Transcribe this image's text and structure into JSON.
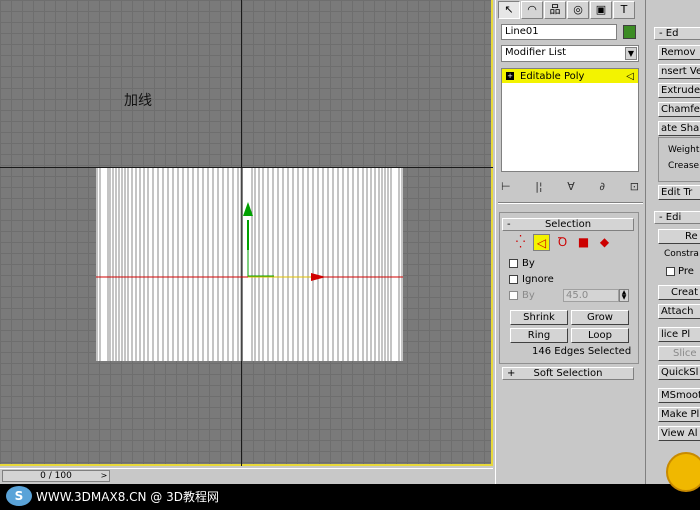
{
  "viewport": {
    "label": "加线",
    "mesh_line_color": "#ffffff",
    "axis_x_color": "#d00000",
    "axis_y_color": "#00a000"
  },
  "timeline": {
    "value": "0 / 100",
    "arrow": ">"
  },
  "watermark": {
    "logo": "S",
    "text": "WWW.3DMAX8.CN @ 3D教程网"
  },
  "command_panel": {
    "tabs": [
      "↖",
      "◠",
      "品",
      "◎",
      "▣",
      "T"
    ],
    "object_name": "Line01",
    "object_color": "#3c8c24",
    "modifier_list": "Modifier List",
    "stack": [
      {
        "label": "Editable Poly",
        "expander": "+"
      }
    ],
    "stack_tools": [
      "⊢",
      "|¦",
      "∀",
      "∂",
      "⊡"
    ],
    "selection": {
      "title": "Selection",
      "collapse": "-",
      "levels": [
        "vertex",
        "edge",
        "border",
        "polygon",
        "element"
      ],
      "by_vertex": "By",
      "ignore": "Ignore",
      "by_angle": "By",
      "angle_value": "45.0",
      "shrink": "Shrink",
      "grow": "Grow",
      "ring": "Ring",
      "loop": "Loop",
      "status": "146 Edges Selected"
    },
    "soft_selection": {
      "title": "Soft Selection",
      "expand": "+"
    }
  },
  "panel2": {
    "head1": "- Ed",
    "btn_remove": "Remov",
    "btn_insert": "nsert Ve",
    "btn_extrude": "Extrude",
    "btn_chamfer": "Chamfer",
    "btn_create_shape": "ate Sha",
    "weight": "Weight:",
    "crease": "Crease:",
    "btn_edit_tri": "Edit Tr",
    "head2": "- Edi",
    "btn_repeat": "Re",
    "constraints": "Constra",
    "preserve": "Pre",
    "btn_create": "Creat",
    "btn_attach": "Attach",
    "btn_slice_plane": "lice Pl",
    "btn_slice": "Slice",
    "btn_quickslice": "QuickSl",
    "btn_msmooth": "MSmooth",
    "btn_make_planar": "Make Pl",
    "btn_view_align": "View Al"
  }
}
